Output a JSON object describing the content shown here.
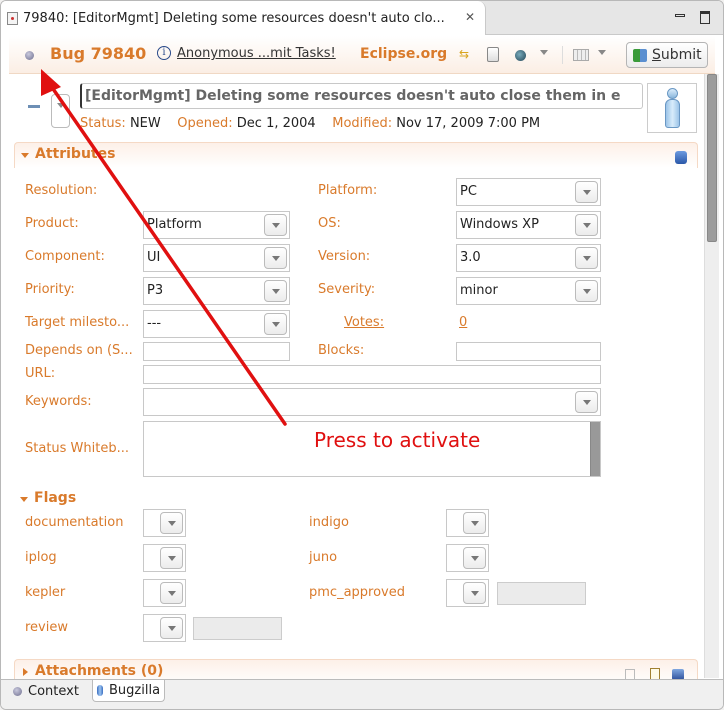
{
  "editor_tab": {
    "title": "79840: [EditorMgmt] Deleting some resources doesn't auto clo...",
    "close_glyph": "✕"
  },
  "header": {
    "bug_title": "Bug 79840",
    "info_glyph": "i",
    "repository_link": "Anonymous ...mit Tasks!",
    "repository_name": "Eclipse.org",
    "submit_label_prefix": "S",
    "submit_label_rest": "ubmit",
    "icons": [
      "synchronize-icon",
      "new-subtask-icon",
      "open-browser-icon",
      "table-icon"
    ]
  },
  "summary": {
    "value": "[EditorMgmt] Deleting some resources doesn't auto close them in e",
    "status_label": "Status:",
    "status_value": "NEW",
    "opened_label": "Opened:",
    "opened_value": "Dec 1, 2004",
    "modified_label": "Modified:",
    "modified_value": "Nov 17, 2009 7:00 PM"
  },
  "attributes": {
    "title": "Attributes",
    "resolution_label": "Resolution:",
    "product_label": "Product:",
    "product_value": "Platform",
    "component_label": "Component:",
    "component_value": "UI",
    "priority_label": "Priority:",
    "priority_value": "P3",
    "target_label": "Target milesto...",
    "target_value": "---",
    "depends_label": "Depends on (S...",
    "depends_value": "",
    "url_label": "URL:",
    "url_value": "",
    "keywords_label": "Keywords:",
    "keywords_value": "",
    "whiteboard_label": "Status Whiteb...",
    "whiteboard_value": "",
    "platform_label": "Platform:",
    "platform_value": "PC",
    "os_label": "OS:",
    "os_value": "Windows XP",
    "version_label": "Version:",
    "version_value": "3.0",
    "severity_label": "Severity:",
    "severity_value": "minor",
    "votes_label": "Votes:",
    "votes_value": "0",
    "blocks_label": "Blocks:",
    "blocks_value": ""
  },
  "flags": {
    "title": "Flags",
    "items": [
      {
        "label": "documentation",
        "value": ""
      },
      {
        "label": "iplog",
        "value": ""
      },
      {
        "label": "kepler",
        "value": ""
      },
      {
        "label": "review",
        "value": ""
      },
      {
        "label": "indigo",
        "value": ""
      },
      {
        "label": "juno",
        "value": ""
      },
      {
        "label": "pmc_approved",
        "value": ""
      }
    ]
  },
  "attachments": {
    "title": "Attachments (0)"
  },
  "bottom_tabs": {
    "context": "Context",
    "bugzilla": "Bugzilla"
  },
  "annotation": {
    "text": "Press to activate",
    "color": "#e01010"
  },
  "colors": {
    "accent": "#d97a2b",
    "annotation": "#e01010"
  }
}
